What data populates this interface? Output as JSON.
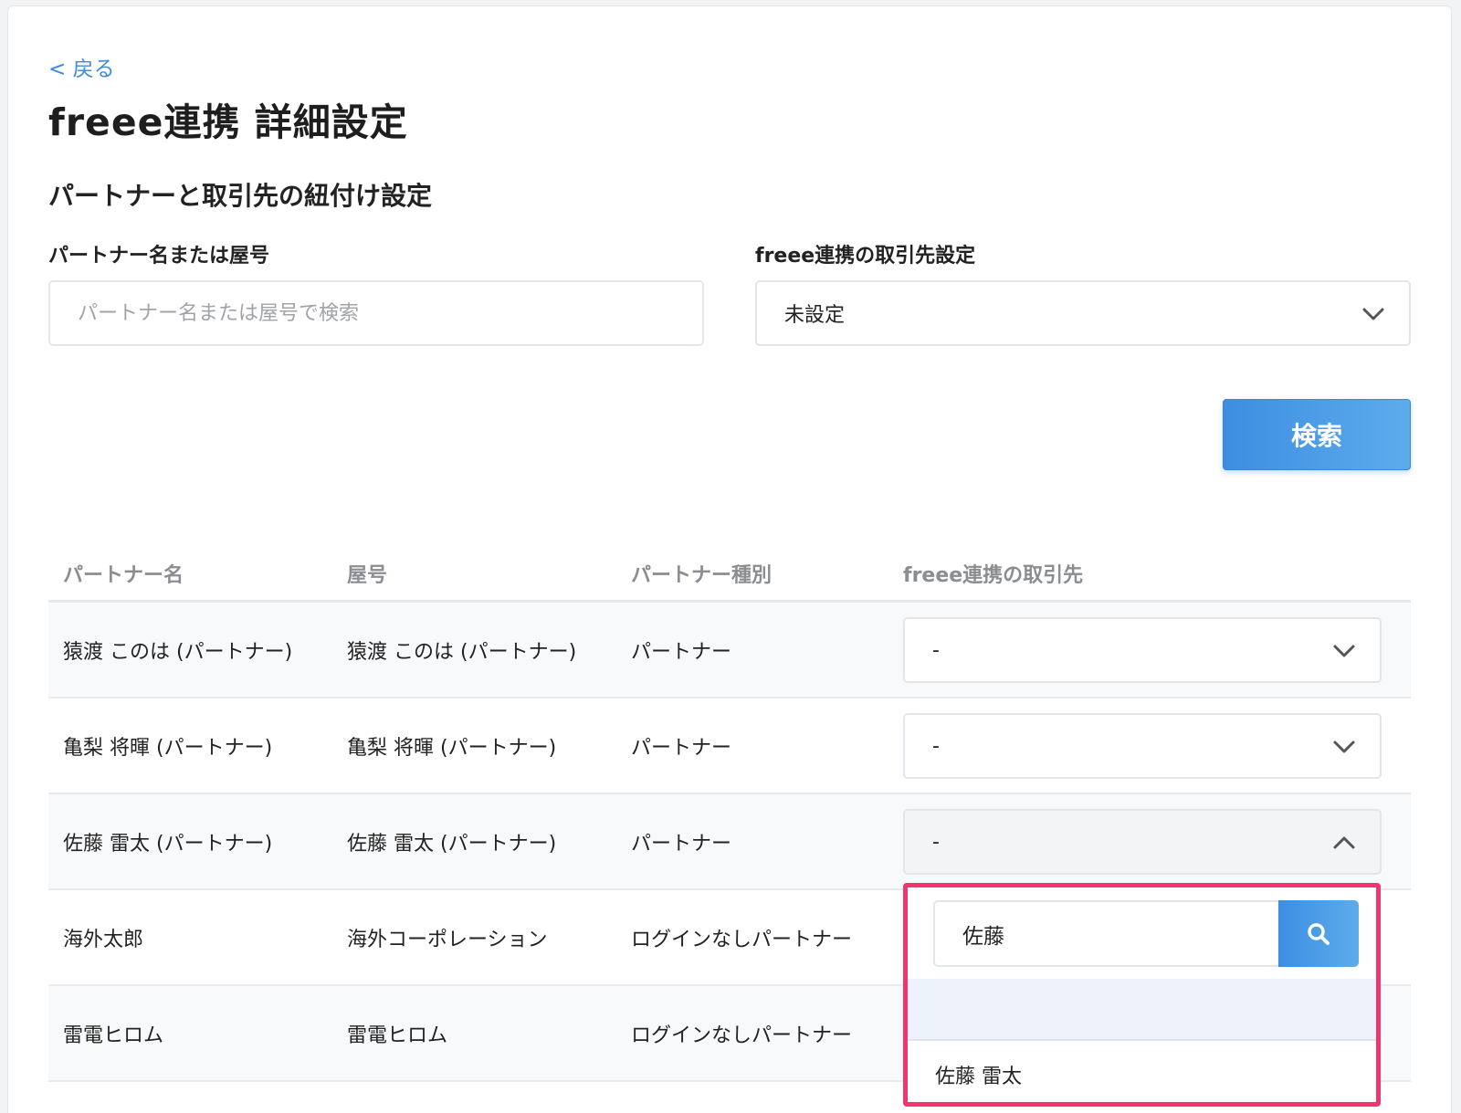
{
  "header": {
    "back_label": "< 戻る",
    "title": "freee連携 詳細設定"
  },
  "section": {
    "title": "パートナーと取引先の紐付け設定"
  },
  "filters": {
    "partner_label": "パートナー名または屋号",
    "partner_placeholder": "パートナー名または屋号で検索",
    "client_label": "freee連携の取引先設定",
    "client_selected": "未設定",
    "search_button": "検索"
  },
  "table": {
    "headers": [
      "パートナー名",
      "屋号",
      "パートナー種別",
      "freee連携の取引先"
    ],
    "rows": [
      {
        "name": "猿渡 このは (パートナー)",
        "trade_name": "猿渡 このは (パートナー)",
        "type": "パートナー",
        "client": "-"
      },
      {
        "name": "亀梨 将暉 (パートナー)",
        "trade_name": "亀梨 将暉 (パートナー)",
        "type": "パートナー",
        "client": "-"
      },
      {
        "name": "佐藤 雷太 (パートナー)",
        "trade_name": "佐藤 雷太 (パートナー)",
        "type": "パートナー",
        "client": "-"
      },
      {
        "name": "海外太郎",
        "trade_name": "海外コーポレーション",
        "type": "ログインなしパートナー"
      },
      {
        "name": "雷電ヒロム",
        "trade_name": "雷電ヒロム",
        "type": "ログインなしパートナー"
      }
    ]
  },
  "dropdown": {
    "search_value": "佐藤",
    "options": [
      "",
      "佐藤 雷太"
    ]
  },
  "colors": {
    "accent": "#3d8ee2",
    "highlight": "#f2356e"
  },
  "icons": {
    "chevron_down": "chevron-down-icon",
    "chevron_up": "chevron-up-icon",
    "search": "search-icon"
  }
}
